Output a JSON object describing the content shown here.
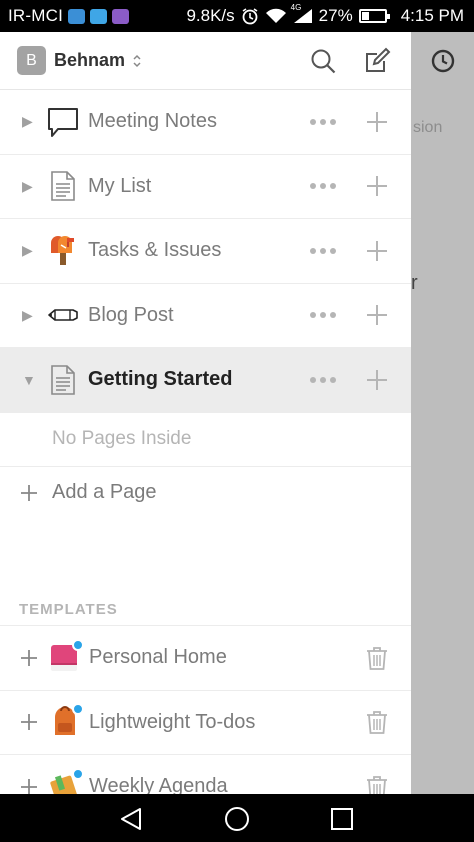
{
  "status_bar": {
    "carrier": "IR-MCI",
    "speed": "9.8K/s",
    "network": "4G",
    "battery": "27%",
    "time": "4:15 PM"
  },
  "header": {
    "workspace_initial": "B",
    "workspace_name": "Behnam"
  },
  "background_page": {
    "text_1": "sion",
    "text_2": "r"
  },
  "pages": [
    {
      "label": "Meeting Notes",
      "icon": "speech-bubble-icon",
      "expanded": false
    },
    {
      "label": "My List",
      "icon": "document-icon",
      "expanded": false
    },
    {
      "label": "Tasks & Issues",
      "icon": "mailbox-icon",
      "expanded": false
    },
    {
      "label": "Blog Post",
      "icon": "pencil-icon",
      "expanded": false
    },
    {
      "label": "Getting Started",
      "icon": "document-icon",
      "expanded": true
    }
  ],
  "no_pages_text": "No Pages Inside",
  "add_page_label": "Add a Page",
  "templates_heading": "TEMPLATES",
  "templates": [
    {
      "label": "Personal Home",
      "icon": "book-icon"
    },
    {
      "label": "Lightweight To-dos",
      "icon": "backpack-icon"
    },
    {
      "label": "Weekly Agenda",
      "icon": "notepad-icon"
    }
  ],
  "colors": {
    "accent_blue": "#2aa4e8",
    "selected_row": "#ececec",
    "muted_text": "#7b7b7b"
  }
}
